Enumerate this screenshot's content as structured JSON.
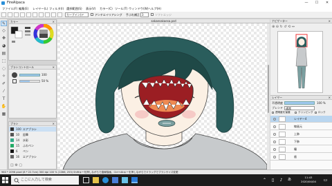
{
  "window": {
    "app_title": "FireAlpaca",
    "minimize": "—",
    "maximize": "☐",
    "close": "✕"
  },
  "menu": [
    "ファイル(F)",
    "編集(E)",
    "レイヤー(L)",
    "フィルタ(I)",
    "選択範囲(S)",
    "表示(V)",
    "カラー(C)",
    "ツール(T)",
    "ウィンドウ(W)",
    "ヘルプ(H)"
  ],
  "toolbar": {
    "brush_mode": "カーブイン(ド",
    "antialias_label": "アンチエイリアシング",
    "stabilizer_label": "手ぶれ補正",
    "stabilizer_value": "3",
    "softedge_label": "ソフトエッジ"
  },
  "panels": {
    "color_title": "カラー",
    "brush_control_title": "ブラシコントロール",
    "brush_size": "100",
    "brush_opacity": "50 %",
    "brush_title": "ブラシ",
    "brushes": [
      {
        "size": "100",
        "name": "エアブラシ"
      },
      {
        "size": "10",
        "name": "鉛筆"
      },
      {
        "size": "14",
        "name": "水彩"
      },
      {
        "size": "15",
        "name": "ふわペン"
      },
      {
        "size": "6",
        "name": "ペン"
      },
      {
        "size": "16",
        "name": "エアブラシ"
      }
    ]
  },
  "canvas": {
    "document_name": "sakaesakaesa.psd"
  },
  "navigator": {
    "title": "ナビゲーター"
  },
  "layers": {
    "title": "レイヤー",
    "opacity_label": "不透明度",
    "opacity_value": "100 %",
    "blend_label": "ブレンド",
    "blend_value": "通常",
    "protect_label": "透明度を保護",
    "clipping_label": "クリッピング",
    "lock_label": "ロック",
    "items": [
      "レイヤー4",
      "線画元",
      "上肺",
      "下肺",
      "瞳",
      "歯"
    ],
    "selected_index": 0
  },
  "statusbar": {
    "text": "960 * 2096 pixel (8 * 22.7cm) 300 dpi 100 % (1066, 253) Shiftキーを押しながらで直線描画、Ctrl+Altキーを押しながらでドラッグでブラシサイズ変更"
  },
  "taskbar": {
    "search_placeholder": "ここに入力して検索",
    "time": "11:43",
    "date": "2020/04/04"
  },
  "colors": {
    "hair": "#2a5d5c",
    "hair_dark": "#1f4947",
    "skin": "#fbf0e4",
    "mouth": "#9b1e23",
    "tongue": "#ee8a52",
    "shirt": "#c7cacc",
    "mask": "#7a9fa0",
    "accent": "#2a8fd8"
  }
}
